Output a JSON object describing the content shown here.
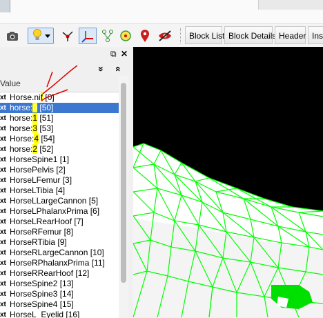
{
  "toolbar": {
    "icons": [
      "camera-icon",
      "lightbulb-icon",
      "dropdown-arrow-icon",
      "vertex-icon",
      "axes-icon",
      "skeleton-icon",
      "yellow-circle-icon",
      "location-pin-icon",
      "hide-eye-icon"
    ],
    "buttons": [
      "Block List",
      "Block Details",
      "Header",
      "Ins"
    ]
  },
  "panel": {
    "float_label": "⧉",
    "close_label": "✕",
    "column_header": "Value",
    "collapse_label": "»",
    "expand_label": "«"
  },
  "rows": [
    {
      "icon": "xt",
      "pre": "Horse.ni",
      "hl": "f",
      "post": " [0]",
      "selected": false
    },
    {
      "icon": "xt",
      "pre": "horse:",
      "hl": "0",
      "post": " [50]",
      "selected": true
    },
    {
      "icon": "xt",
      "pre": "horse:",
      "hl": "1",
      "post": " [51]",
      "selected": false
    },
    {
      "icon": "xt",
      "pre": "horse:",
      "hl": "3",
      "post": " [53]",
      "selected": false
    },
    {
      "icon": "xt",
      "pre": "Horse:",
      "hl": "4",
      "post": " [54]",
      "selected": false
    },
    {
      "icon": "xt",
      "pre": "horse:",
      "hl": "2",
      "post": " [52]",
      "selected": false
    },
    {
      "icon": "xt",
      "pre": "HorseSpine1 [1]",
      "hl": "",
      "post": "",
      "selected": false
    },
    {
      "icon": "xt",
      "pre": "HorsePelvis [2]",
      "hl": "",
      "post": "",
      "selected": false
    },
    {
      "icon": "xt",
      "pre": "HorseLFemur [3]",
      "hl": "",
      "post": "",
      "selected": false
    },
    {
      "icon": "xt",
      "pre": "HorseLTibia [4]",
      "hl": "",
      "post": "",
      "selected": false
    },
    {
      "icon": "xt",
      "pre": "HorseLLargeCannon [5]",
      "hl": "",
      "post": "",
      "selected": false
    },
    {
      "icon": "xt",
      "pre": "HorseLPhalanxPrima [6]",
      "hl": "",
      "post": "",
      "selected": false
    },
    {
      "icon": "xt",
      "pre": "HorseLRearHoof [7]",
      "hl": "",
      "post": "",
      "selected": false
    },
    {
      "icon": "xt",
      "pre": "HorseRFemur [8]",
      "hl": "",
      "post": "",
      "selected": false
    },
    {
      "icon": "xt",
      "pre": "HorseRTibia [9]",
      "hl": "",
      "post": "",
      "selected": false
    },
    {
      "icon": "xt",
      "pre": "HorseRLargeCannon [10]",
      "hl": "",
      "post": "",
      "selected": false
    },
    {
      "icon": "xt",
      "pre": "HorseRPhalanxPrima [11]",
      "hl": "",
      "post": "",
      "selected": false
    },
    {
      "icon": "xt",
      "pre": "HorseRRearHoof [12]",
      "hl": "",
      "post": "",
      "selected": false
    },
    {
      "icon": "xt",
      "pre": "HorseSpine2 [13]",
      "hl": "",
      "post": "",
      "selected": false
    },
    {
      "icon": "xt",
      "pre": "HorseSpine3 [14]",
      "hl": "",
      "post": "",
      "selected": false
    },
    {
      "icon": "xt",
      "pre": "HorseSpine4 [15]",
      "hl": "",
      "post": "",
      "selected": false
    },
    {
      "icon": "xt",
      "pre": "HorseL_Eyelid [16]",
      "hl": "",
      "post": "",
      "selected": false
    }
  ],
  "colors": {
    "selection": "#3c78d0",
    "highlight": "#ffff00",
    "annotation": "#e00000",
    "mesh": "#00ff00"
  }
}
